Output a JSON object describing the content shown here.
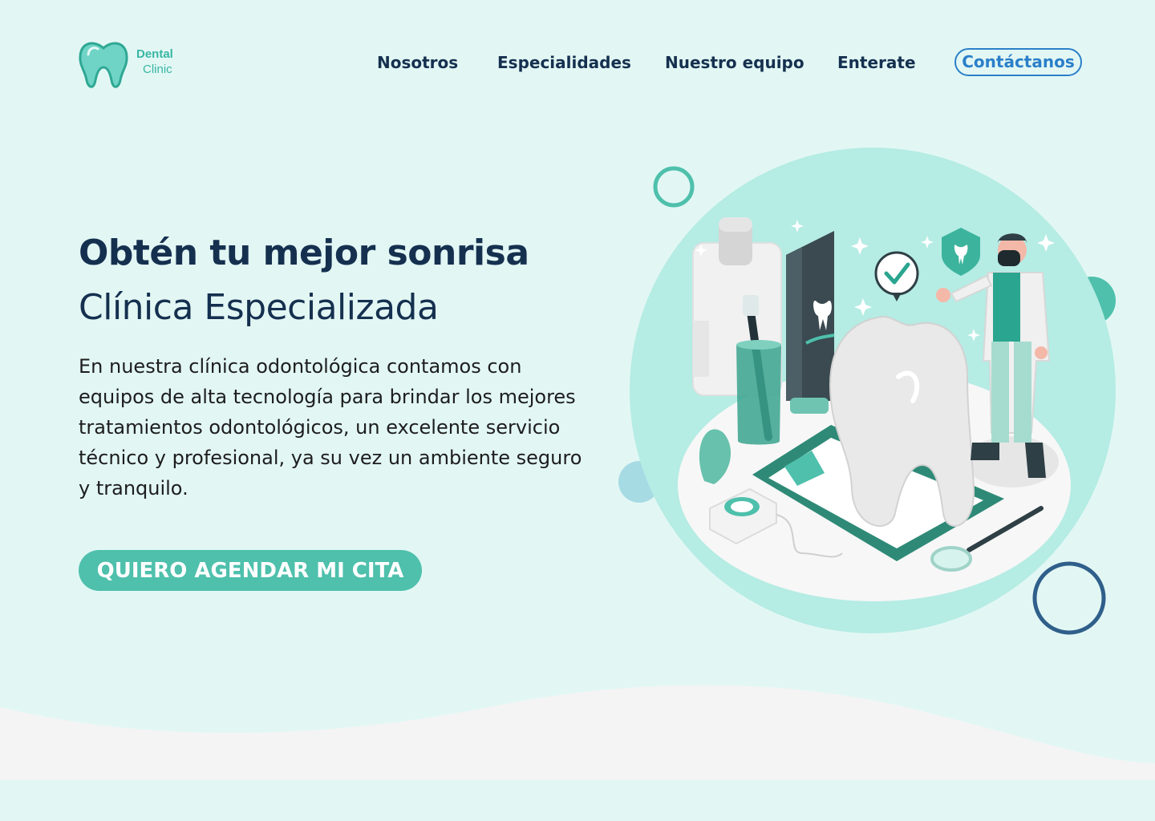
{
  "brand": {
    "line1": "Dental",
    "line2": "Clinic"
  },
  "nav": {
    "items": [
      "Nosotros",
      "Especialidades",
      "Nuestro equipo",
      "Enterate"
    ],
    "contact": "Contáctanos"
  },
  "hero": {
    "title": "Obtén tu mejor sonrisa",
    "subtitle": "Clínica Especializada",
    "description": "En nuestra clínica odontológica contamos con equipos de alta tecnología para brindar los mejores tratamientos odontológicos, un excelente servicio técnico y profesional, ya su vez un ambiente seguro y tranquilo.",
    "cta": "QUIERO AGENDAR MI CITA"
  },
  "colors": {
    "background": "#e2f7f4",
    "accent": "#4ec0ac",
    "navy": "#15304f",
    "link_blue": "#2b7fc9",
    "footer_band": "#f4f4f4"
  },
  "icons": [
    "tooth-logo-icon",
    "checkmark-bubble-icon",
    "shield-tooth-icon"
  ]
}
